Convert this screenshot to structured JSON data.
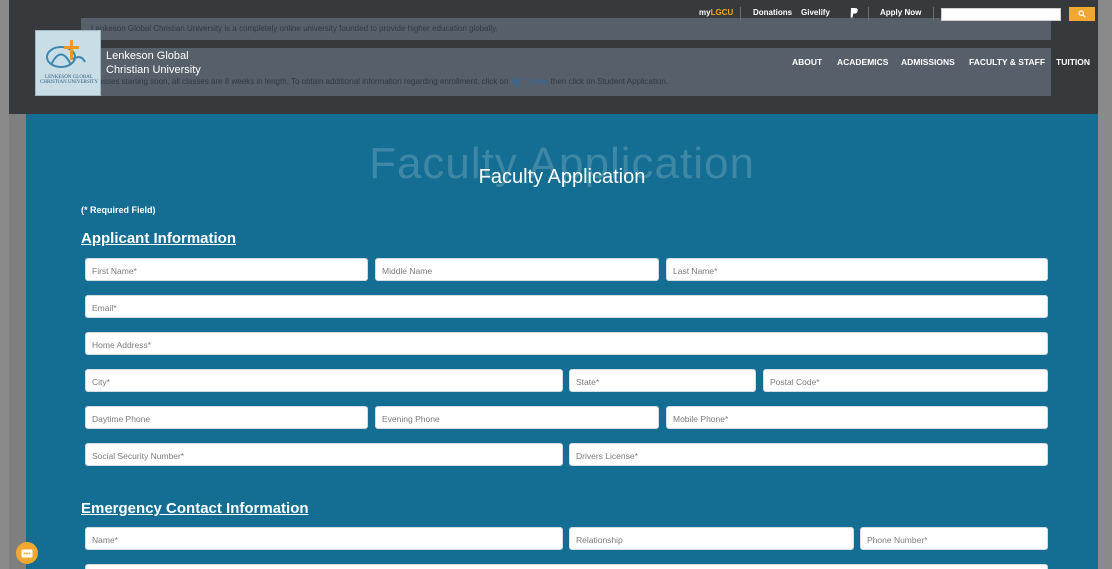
{
  "topbar": {
    "mylgcu_prefix": "my",
    "mylgcu_accent": "LGCU",
    "donations": "Donations",
    "givelify": "Givelify",
    "apply_now": "Apply Now",
    "search_placeholder": "",
    "search_icon": "search-icon"
  },
  "announcements": {
    "line1": "Lenkeson Global Christian University is a completely online university founded to provide higher education globally.",
    "line2_prefix": "Classes starting soon, all classes are 8 weeks in length. To obtain additional information regarding enrollment, click on ",
    "line2_link": "Apply Now",
    "line2_suffix": " then click on Student Application."
  },
  "brand": {
    "name_line1": "Lenkeson Global",
    "name_line2": "Christian University",
    "logo_tag_line1": "LENKESON GLOBAL",
    "logo_tag_line2": "CHRISTIAN UNIVERSITY"
  },
  "nav": {
    "about": "ABOUT",
    "academics": "ACADEMICS",
    "admissions": "ADMISSIONS",
    "faculty_staff": "FACULTY & STAFF",
    "tuition": "TUITION"
  },
  "page": {
    "hero_shadow": "Faculty Application",
    "title": "Faculty Application",
    "required_note": "(* Required Field)"
  },
  "applicant": {
    "heading": "Applicant Information",
    "first_name": "First Name*",
    "middle_name": "Middle Name",
    "last_name": "Last Name*",
    "email": "Email*",
    "home_address": "Home Address*",
    "city": "City*",
    "state": "State*",
    "postal_code": "Postal Code*",
    "daytime_phone": "Daytime Phone",
    "evening_phone": "Evening Phone",
    "mobile_phone": "Mobile Phone*",
    "ssn": "Social Security Number*",
    "drivers_license": "Drivers License*"
  },
  "emergency": {
    "heading": "Emergency Contact Information",
    "name": "Name*",
    "relationship": "Relationship",
    "phone_number": "Phone Number*"
  },
  "colors": {
    "header_bg": "#363a3d",
    "content_bg": "#146d92",
    "accent": "#f5a623"
  }
}
